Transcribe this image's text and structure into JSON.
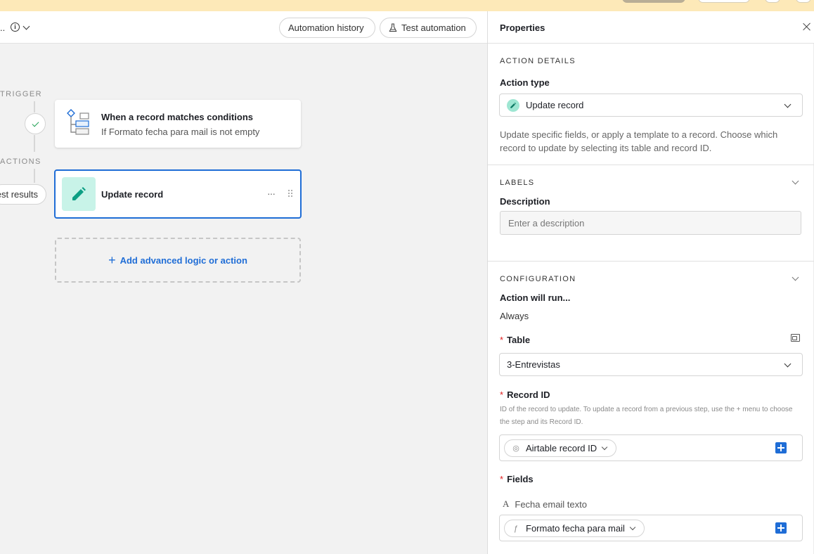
{
  "header": {
    "name_truncated": "..",
    "info_icon_char": "i",
    "automation_history": "Automation history",
    "test_automation": "Test automation"
  },
  "canvas": {
    "trigger_label": "TRIGGER",
    "actions_label": "ACTIONS",
    "test_results": "Test results",
    "trigger_card": {
      "title": "When a record matches conditions",
      "subtitle": "If Formato fecha para mail is not empty"
    },
    "action_card": {
      "title": "Update record",
      "more": "···"
    },
    "add_logic": "Add advanced logic or action",
    "add_plus": "+"
  },
  "panel": {
    "title": "Properties",
    "action_details": {
      "heading": "ACTION DETAILS",
      "action_type_label": "Action type",
      "action_type_value": "Update record",
      "description": "Update specific fields, or apply a template to a record. Choose which record to update by selecting its table and record ID."
    },
    "labels": {
      "heading": "LABELS",
      "description_label": "Description",
      "description_placeholder": "Enter a description"
    },
    "configuration": {
      "heading": "CONFIGURATION",
      "action_will_run_label": "Action will run...",
      "action_will_run_value": "Always",
      "required_mark": "*",
      "table_label": "Table",
      "table_value": "3-Entrevistas",
      "record_id_label": "Record ID",
      "record_id_help": "ID of the record to update. To update a record from a previous step, use the + menu to choose the step and its Record ID.",
      "record_id_token": "Airtable record ID",
      "fields_label": "Fields",
      "field_name": "Fecha email texto",
      "field_token": "Formato fecha para mail"
    }
  },
  "colors": {
    "accent_blue": "#1f6dd6",
    "banner_yellow": "#fde9b8",
    "action_icon_bg": "#c8f3e8",
    "action_icon_fg": "#0d9f84",
    "success_green": "#20a153",
    "required_red": "#e02020"
  },
  "icons": [
    "info-icon",
    "chevron-down-icon",
    "flask-icon",
    "check-icon",
    "tree-icon",
    "pencil-icon",
    "more-icon",
    "drag-handle-icon",
    "plus-icon",
    "close-icon",
    "expand-icon",
    "fingerprint-icon",
    "formula-icon",
    "text-field-icon"
  ]
}
